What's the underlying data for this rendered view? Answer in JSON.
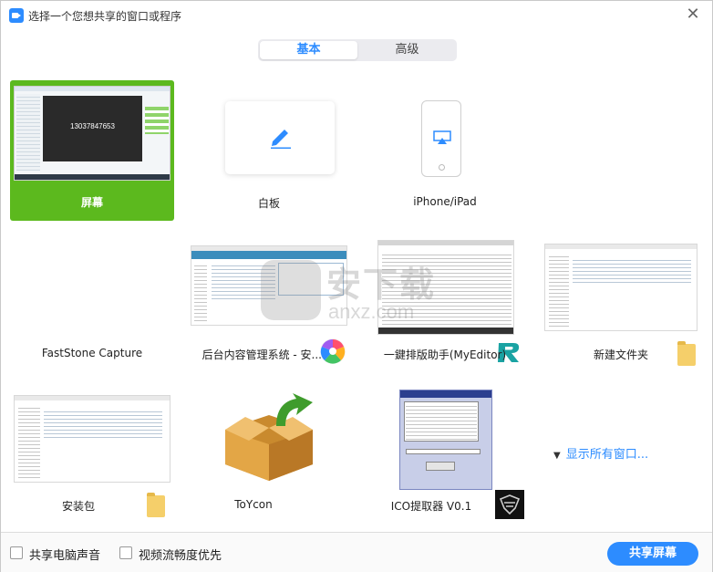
{
  "window": {
    "title": "选择一个您想共享的窗口或程序",
    "close_glyph": "✕"
  },
  "tabs": [
    {
      "label": "基本",
      "selected": true
    },
    {
      "label": "高级",
      "selected": false
    }
  ],
  "screen_tile": {
    "label": "屏幕",
    "meeting_id": "13037847653",
    "selected": true,
    "accent_color": "#5cb91e"
  },
  "tiles": [
    {
      "label": "白板",
      "icon": "pen-icon"
    },
    {
      "label": "iPhone/iPad",
      "icon": "airplay-icon"
    },
    {
      "label": "FastStone Capture"
    },
    {
      "label": "后台内容管理系统 - 安...",
      "icon": "browser-app-icon"
    },
    {
      "label": "一鍵排版助手(MyEditor)",
      "icon": "myeditor-app-icon"
    },
    {
      "label": "新建文件夹",
      "icon": "folder-icon"
    },
    {
      "label": "安装包",
      "icon": "folder-icon"
    },
    {
      "label": "ToYcon",
      "icon": "box-arrow-icon"
    },
    {
      "label": "ICO提取器 V0.1",
      "icon": "ico-extractor-icon"
    }
  ],
  "show_all": {
    "label": "显示所有窗口...",
    "icon": "expand-down-icon"
  },
  "watermark": {
    "cn": "安下载",
    "en": "anxz.com"
  },
  "footer": {
    "share_audio_label": "共享电脑声音",
    "video_priority_label": "视频流畅度优先",
    "share_button_label": "共享屏幕",
    "share_audio_checked": false,
    "video_priority_checked": false
  },
  "colors": {
    "accent_blue": "#2d8cff",
    "selected_green": "#5cb91e"
  }
}
